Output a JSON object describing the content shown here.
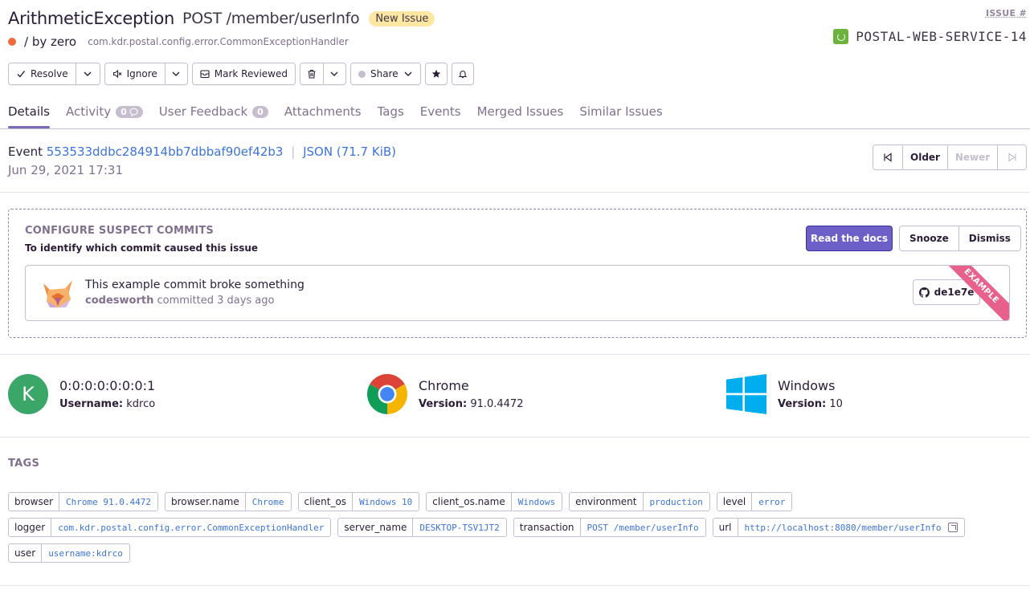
{
  "header": {
    "exception": "ArithmeticException",
    "culprit": "POST /member/userInfo",
    "status_badge": "New Issue",
    "message": "/ by zero",
    "location": "com.kdr.postal.config.error.CommonExceptionHandler",
    "issue_label": "ISSUE #",
    "issue_id": "POSTAL-WEB-SERVICE-14",
    "level_color": "#f06b3a",
    "project_color": "#6cb33e"
  },
  "toolbar": {
    "resolve": "Resolve",
    "ignore": "Ignore",
    "mark_reviewed": "Mark Reviewed",
    "share": "Share"
  },
  "tabs": [
    {
      "label": "Details"
    },
    {
      "label": "Activity",
      "count": "0"
    },
    {
      "label": "User Feedback",
      "count": "0"
    },
    {
      "label": "Attachments"
    },
    {
      "label": "Tags"
    },
    {
      "label": "Events"
    },
    {
      "label": "Merged Issues"
    },
    {
      "label": "Similar Issues"
    }
  ],
  "event": {
    "label": "Event",
    "id": "553533ddbc284914bb7dbbaf90ef42b3",
    "json": "JSON (71.7 KiB)",
    "date": "Jun 29, 2021 17:31",
    "older": "Older",
    "newer": "Newer"
  },
  "suspect": {
    "title": "CONFIGURE SUSPECT COMMITS",
    "subtitle": "To identify which commit caused this issue",
    "read_docs": "Read the docs",
    "snooze": "Snooze",
    "dismiss": "Dismiss",
    "commit_message": "This example commit broke something",
    "author": "codesworth",
    "committed_when": "committed 3 days ago",
    "sha": "de1e7e",
    "ribbon": "EXAMPLE"
  },
  "context": {
    "user": {
      "initial": "K",
      "title": "0:0:0:0:0:0:0:1",
      "sub_label": "Username:",
      "sub_value": "kdrco"
    },
    "browser": {
      "title": "Chrome",
      "sub_label": "Version:",
      "sub_value": "91.0.4472"
    },
    "os": {
      "title": "Windows",
      "sub_label": "Version:",
      "sub_value": "10"
    }
  },
  "tags_title": "TAGS",
  "tags": [
    {
      "key": "browser",
      "value": "Chrome 91.0.4472"
    },
    {
      "key": "browser.name",
      "value": "Chrome"
    },
    {
      "key": "client_os",
      "value": "Windows 10"
    },
    {
      "key": "client_os.name",
      "value": "Windows"
    },
    {
      "key": "environment",
      "value": "production"
    },
    {
      "key": "level",
      "value": "error"
    },
    {
      "key": "logger",
      "value": "com.kdr.postal.config.error.CommonExceptionHandler"
    },
    {
      "key": "server_name",
      "value": "DESKTOP-TSV1JT2"
    },
    {
      "key": "transaction",
      "value": "POST /member/userInfo"
    },
    {
      "key": "url",
      "value": "http://localhost:8080/member/userInfo",
      "external": true
    },
    {
      "key": "user",
      "value": "username:kdrco"
    }
  ]
}
